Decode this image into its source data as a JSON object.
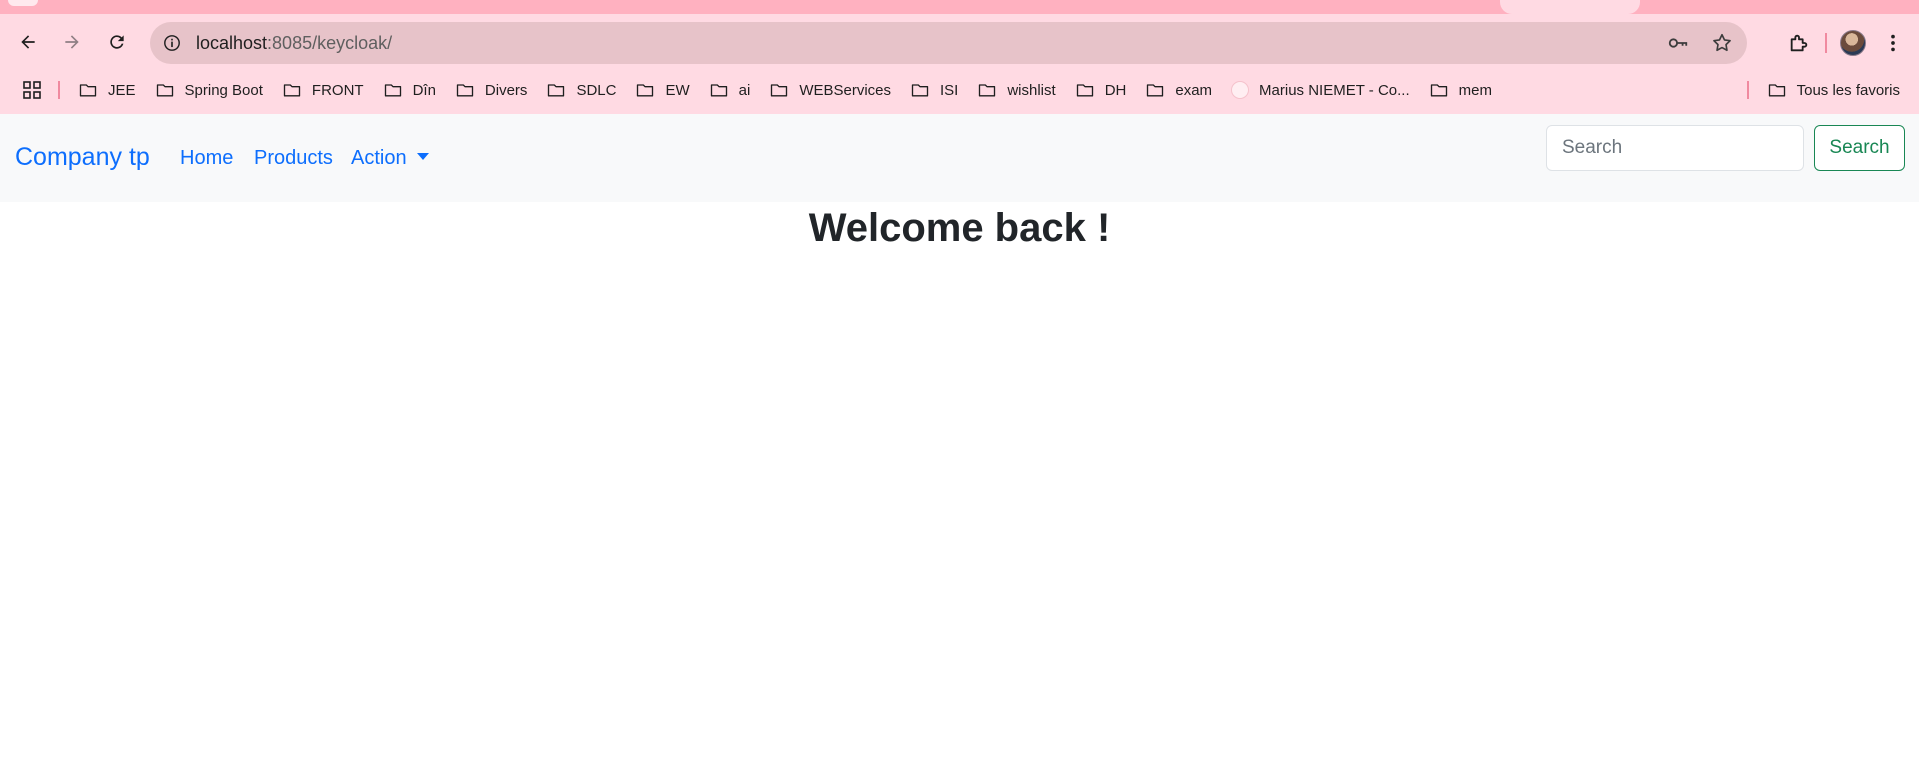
{
  "browser": {
    "url_host": "localhost",
    "url_path": ":8085/keycloak/",
    "bookmarks": [
      "JEE",
      "Spring Boot",
      "FRONT",
      "Dîn",
      "Divers",
      "SDLC",
      "EW",
      "ai",
      "WEBServices",
      "ISI",
      "wishlist",
      "DH",
      "exam"
    ],
    "bookmark_site": "Marius NIEMET - Co...",
    "bookmark_last": "mem",
    "all_bookmarks": "Tous les favoris"
  },
  "navbar": {
    "brand": "Company tp",
    "links": [
      "Home",
      "Products",
      "Action"
    ],
    "search_placeholder": "Search",
    "search_button": "Search"
  },
  "main": {
    "heading": "Welcome back !"
  },
  "colors": {
    "chrome_bg": "#ffdae3",
    "tabstrip": "#ffb1c0",
    "omnibox": "#e7c3c9",
    "link": "#0d6efd",
    "success": "#198754",
    "navbar_bg": "#f8f9fa"
  }
}
